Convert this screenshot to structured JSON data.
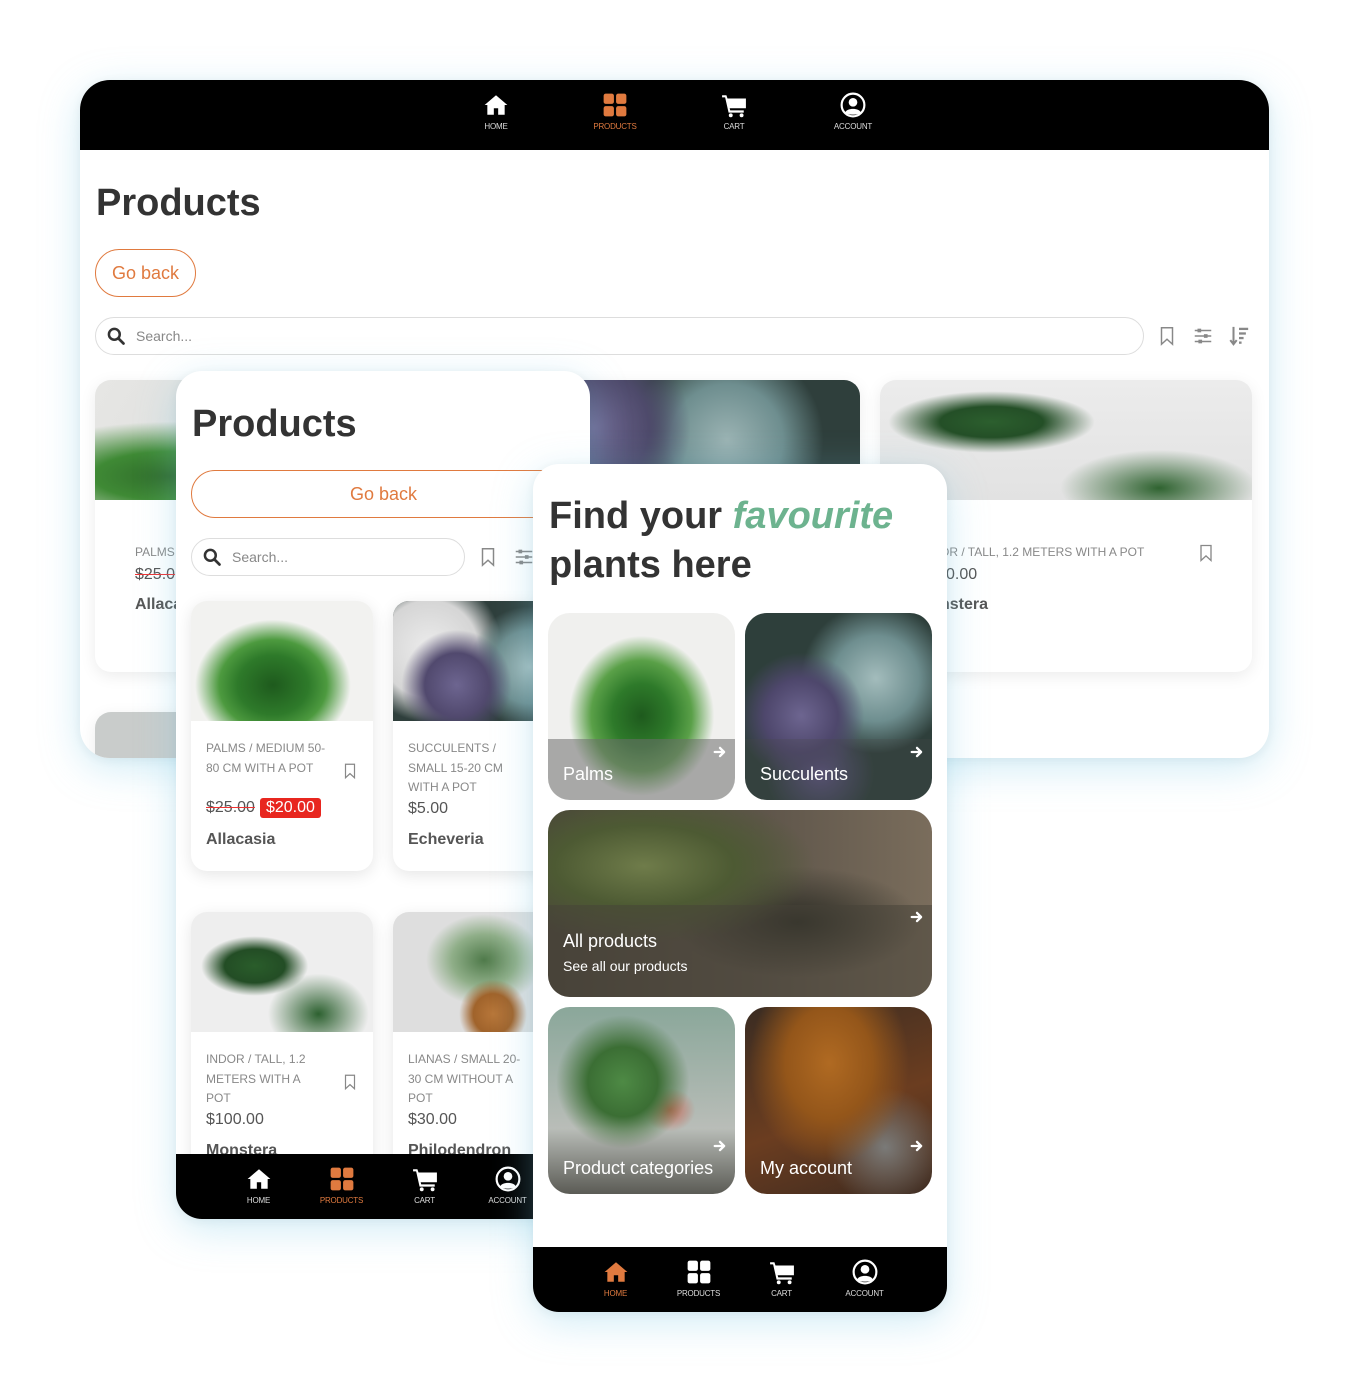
{
  "colors": {
    "accent": "#e07a3f",
    "brand_green": "#6db38f",
    "sale_red": "#e8261f",
    "nav_bg": "#000000"
  },
  "nav": {
    "items": [
      {
        "label": "HOME",
        "icon": "home-icon"
      },
      {
        "label": "PRODUCTS",
        "icon": "grid-icon"
      },
      {
        "label": "CART",
        "icon": "cart-icon"
      },
      {
        "label": "ACCOUNT",
        "icon": "account-icon"
      }
    ]
  },
  "desktop": {
    "active_nav": "PRODUCTS",
    "title": "Products",
    "go_back": "Go back",
    "search_placeholder": "Search...",
    "cards": [
      {
        "category": "PALMS",
        "price_old": "$25.0",
        "name": "Allaca"
      },
      {
        "category": "OR / TALL, 1.2 METERS WITH A POT",
        "price": "0.00",
        "name": "nstera"
      }
    ]
  },
  "mobile_products": {
    "active_nav": "PRODUCTS",
    "title": "Products",
    "go_back": "Go back",
    "search_placeholder": "Search...",
    "products": [
      {
        "category": "PALMS / MEDIUM 50-80 CM WITH A POT",
        "price_old": "$25.00",
        "price": "$20.00",
        "name": "Allacasia"
      },
      {
        "category": "SUCCULENTS / SMALL 15-20 CM WITH A POT",
        "price": "$5.00",
        "name": "Echeveria"
      },
      {
        "category": "INDOR / TALL, 1.2 METERS WITH A POT",
        "price": "$100.00",
        "name": "Monstera"
      },
      {
        "category": "LIANAS / SMALL 20-30 CM WITHOUT A POT",
        "price": "$30.00",
        "name": "Philodendron"
      }
    ]
  },
  "mobile_home": {
    "active_nav": "HOME",
    "hero_line1": "Find your ",
    "hero_highlight": "favourite",
    "hero_line2": "plants here",
    "tiles": [
      {
        "title": "Palms"
      },
      {
        "title": "Succulents"
      },
      {
        "title": "All products",
        "subtitle": "See all our products"
      },
      {
        "title": "Product categories"
      },
      {
        "title": "My account"
      }
    ]
  }
}
